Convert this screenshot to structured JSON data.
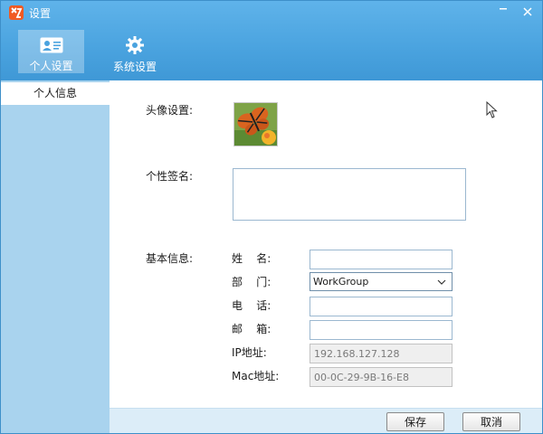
{
  "window": {
    "title": "设置"
  },
  "colors": {
    "header": "#4aa3df",
    "sidebar": "#a9d3ee",
    "footer": "#dcedf8",
    "app_icon": "#f05a22"
  },
  "tabs": [
    {
      "label": "个人设置",
      "icon": "id-card-icon",
      "active": true
    },
    {
      "label": "系统设置",
      "icon": "gear-icon",
      "active": false
    }
  ],
  "sidebar": {
    "items": [
      {
        "label": "个人信息",
        "selected": true
      }
    ]
  },
  "form": {
    "avatar_label": "头像设置:",
    "signature_label": "个性签名:",
    "signature_value": "",
    "basic_info_label": "基本信息:",
    "name": {
      "label": "姓    名:",
      "value": ""
    },
    "department": {
      "label": "部    门:",
      "value": "WorkGroup"
    },
    "phone": {
      "label": "电    话:",
      "value": ""
    },
    "email": {
      "label": "邮    箱:",
      "value": ""
    },
    "ip": {
      "label": "IP地址:",
      "value": "192.168.127.128"
    },
    "mac": {
      "label": "Mac地址:",
      "value": "00-0C-29-9B-16-E8"
    }
  },
  "buttons": {
    "save": "保存",
    "cancel": "取消"
  }
}
